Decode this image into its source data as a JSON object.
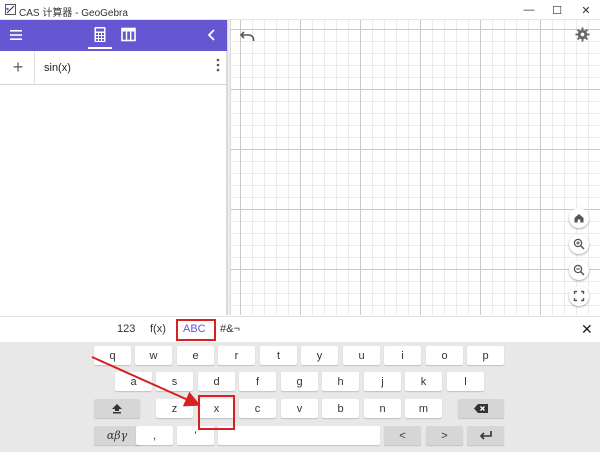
{
  "window": {
    "title": "CAS 计算器 - GeoGebra",
    "minimize": "—",
    "maximize": "☐",
    "close": "✕"
  },
  "toolbar": {
    "accent": "#6557d2",
    "menu_icon": "hamburger-icon",
    "views": [
      "calculator-icon",
      "table-icon"
    ],
    "collapse_icon": "chevron-left-icon"
  },
  "algebra": {
    "add_label": "+",
    "input_value": "sin(x)",
    "more_icon": "vertical-dots-icon"
  },
  "graphics": {
    "undo_icon": "undo-icon",
    "settings_icon": "gear-icon",
    "nav_buttons": [
      "home-icon",
      "zoom-in-icon",
      "zoom-out-icon",
      "fullscreen-icon"
    ]
  },
  "keyboard": {
    "tabs": [
      "123",
      "f(x)",
      "ABC",
      "#&¬"
    ],
    "active_tab": "ABC",
    "close_label": "✕",
    "row1": [
      "q",
      "w",
      "e",
      "r",
      "t",
      "y",
      "u",
      "i",
      "o",
      "p"
    ],
    "row2": [
      "a",
      "s",
      "d",
      "f",
      "g",
      "h",
      "j",
      "k",
      "l"
    ],
    "row3": [
      "z",
      "x",
      "c",
      "v",
      "b",
      "n",
      "m"
    ],
    "greek_label": "αβγ",
    "comma_label": ",",
    "quote_label": "'",
    "left_label": "<",
    "right_label": ">"
  },
  "annotation_color": "#d92020"
}
